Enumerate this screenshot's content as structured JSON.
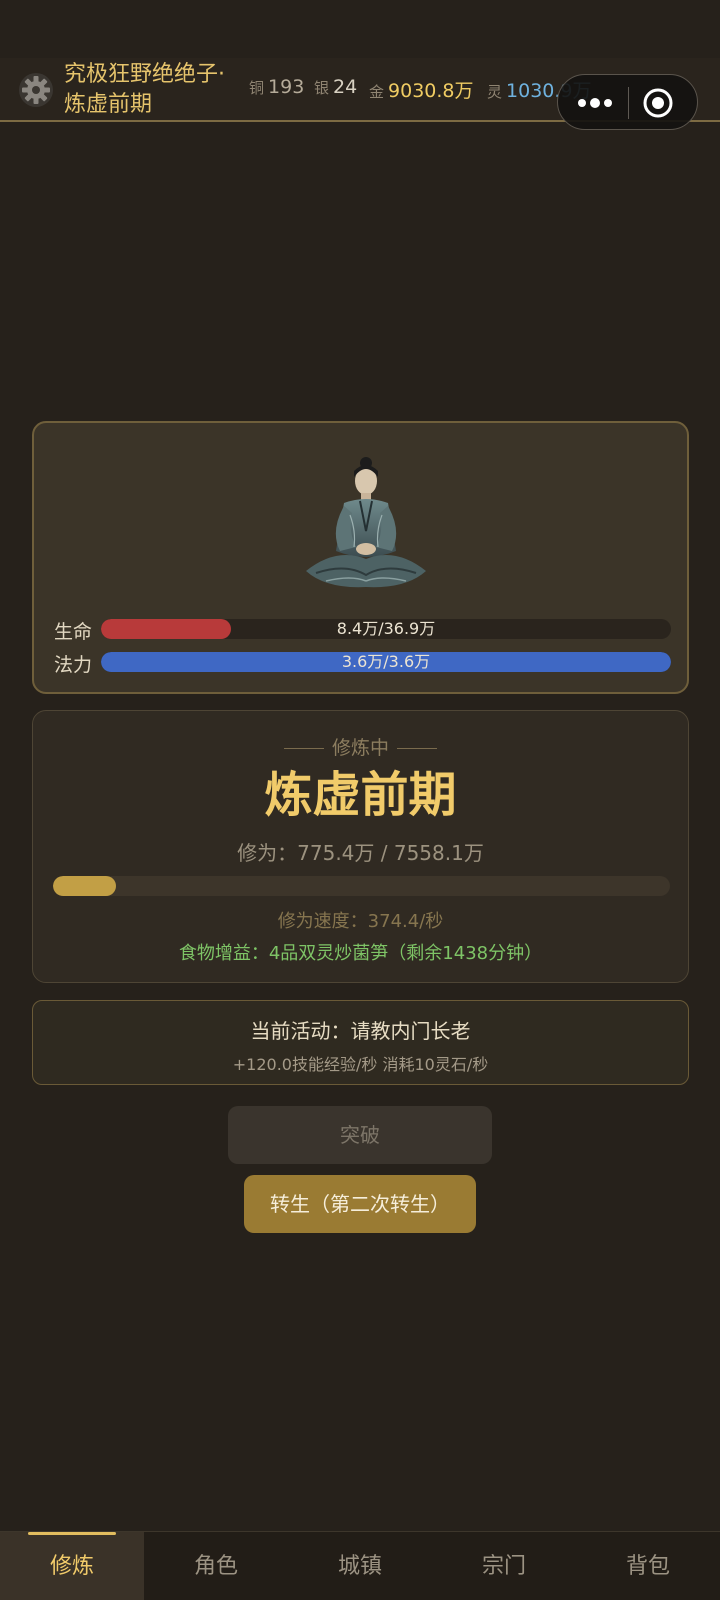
{
  "header": {
    "title_line1": "究极狂野绝绝子·",
    "title_line2": "炼虚前期",
    "currency": {
      "copper_label": "铜",
      "copper_value": "193",
      "silver_label": "银",
      "silver_value": "24",
      "gold_label": "金",
      "gold_value": "9030.8万",
      "spirit_label": "灵",
      "spirit_value": "1030.9万"
    },
    "settings_icon": "gear-icon",
    "capsule": {
      "more_icon": "more-dots-icon",
      "close_icon": "target-circle-icon"
    }
  },
  "character": {
    "portrait": "meditating-cultivator-portrait",
    "hp": {
      "label": "生命",
      "text": "8.4万/36.9万",
      "current": 8.4,
      "max": 36.9
    },
    "mp": {
      "label": "法力",
      "text": "3.6万/3.6万",
      "current": 3.6,
      "max": 3.6
    }
  },
  "cultivation": {
    "status": "修炼中",
    "realm": "炼虚前期",
    "progress_text": "修为：775.4万 / 7558.1万",
    "progress_current": 775.4,
    "progress_max": 7558.1,
    "speed": "修为速度：374.4/秒",
    "food_bonus": "食物增益：4品双灵炒菌笋（剩余1438分钟）"
  },
  "activity": {
    "title": "当前活动：请教内门长老",
    "detail": "+120.0技能经验/秒  消耗10灵石/秒"
  },
  "buttons": {
    "breakthrough": "突破",
    "rebirth": "转生（第二次转生）"
  },
  "nav": {
    "tabs": [
      "修炼",
      "角色",
      "城镇",
      "宗门",
      "背包"
    ],
    "active_index": 0
  },
  "colors": {
    "background": "#26211b",
    "accent_gold": "#f1cb6a",
    "hp_red": "#b83a3a",
    "mp_blue": "#3f68c4",
    "spirit_blue": "#6fb2df",
    "food_green": "#7ec466"
  }
}
